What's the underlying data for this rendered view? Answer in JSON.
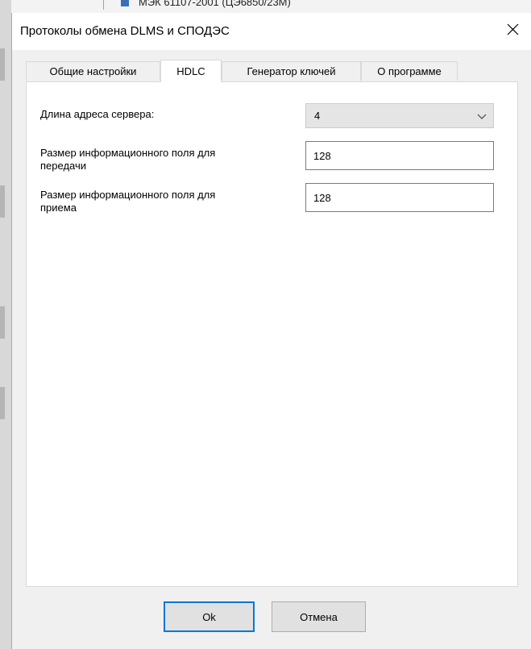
{
  "background": {
    "tree_item_text": "МЭК 61107-2001 (ЦЭ6850/23М)"
  },
  "dialog": {
    "title": "Протоколы обмена DLMS и СПОДЭС",
    "close_symbol": "close-icon"
  },
  "tabs": [
    {
      "label": "Общие настройки",
      "active": false
    },
    {
      "label": "HDLC",
      "active": true
    },
    {
      "label": "Генератор ключей",
      "active": false
    },
    {
      "label": "О программе",
      "active": false
    }
  ],
  "hdlc": {
    "server_address_length_label": "Длина адреса сервера:",
    "server_address_length_value": "4",
    "tx_info_field_label_line1": "Размер информационного поля для",
    "tx_info_field_label_line2": "передачи",
    "tx_info_field_value": "128",
    "rx_info_field_label_line1": "Размер информационного поля для",
    "rx_info_field_label_line2": "приема",
    "rx_info_field_value": "128"
  },
  "buttons": {
    "ok": "Ok",
    "cancel": "Отмена"
  },
  "colors": {
    "accent": "#0078d7",
    "dialog_bg": "#f0f0f0",
    "combo_bg": "#e5e5e5"
  }
}
